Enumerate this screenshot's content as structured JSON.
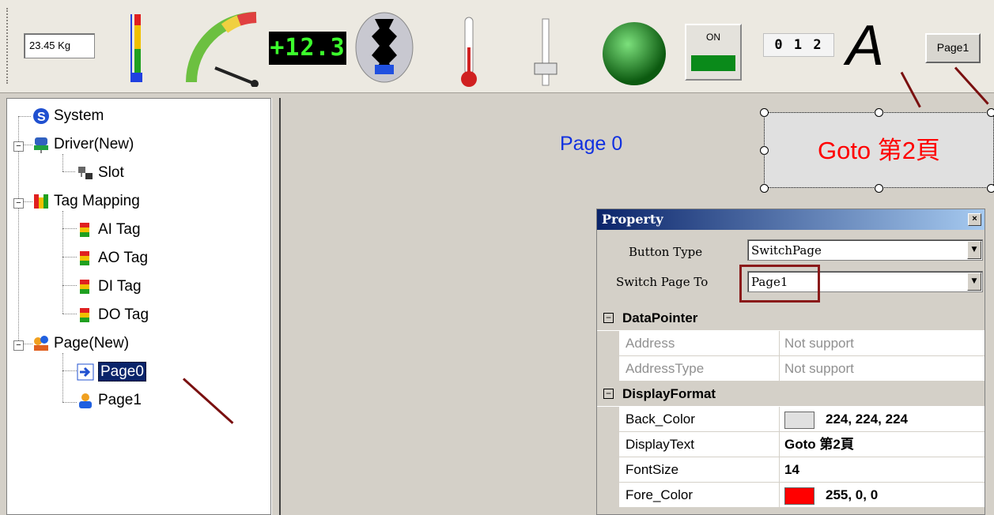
{
  "toolbar": {
    "scale_text": "23.45 Kg",
    "digital_text": "+12.3",
    "on_label": "ON",
    "counter_text": "0 1 2",
    "text_tool": "A",
    "page_button": "Page1"
  },
  "tree": {
    "items": [
      {
        "label": "System"
      },
      {
        "label": "Driver(New)"
      },
      {
        "label": "Slot"
      },
      {
        "label": "Tag Mapping"
      },
      {
        "label": "AI Tag"
      },
      {
        "label": "AO Tag"
      },
      {
        "label": "DI Tag"
      },
      {
        "label": "DO Tag"
      },
      {
        "label": "Page(New)"
      },
      {
        "label": "Page0"
      },
      {
        "label": "Page1"
      }
    ]
  },
  "canvas": {
    "page_title": "Page 0",
    "goto_button": "Goto 第2頁"
  },
  "property": {
    "title": "Property",
    "close": "×",
    "button_type_label": "Button Type",
    "button_type_value": "SwitchPage",
    "switch_page_label": "Switch Page To",
    "switch_page_value": "Page1",
    "categories": [
      {
        "name": "DataPointer",
        "rows": [
          {
            "name": "Address",
            "value": "Not support"
          },
          {
            "name": "AddressType",
            "value": "Not support"
          }
        ]
      },
      {
        "name": "DisplayFormat",
        "rows": [
          {
            "name": "Back_Color",
            "value": "224, 224, 224",
            "swatch": "#e0e0e0"
          },
          {
            "name": "DisplayText",
            "value": "Goto 第2頁"
          },
          {
            "name": "FontSize",
            "value": "14"
          },
          {
            "name": "Fore_Color",
            "value": "255, 0, 0",
            "swatch": "#ff0000"
          }
        ]
      }
    ]
  },
  "colors": {
    "selection": "#0a246a",
    "page_title": "#1030e0",
    "button_text": "#ff0000",
    "annotation_arrow": "#7a1010"
  }
}
